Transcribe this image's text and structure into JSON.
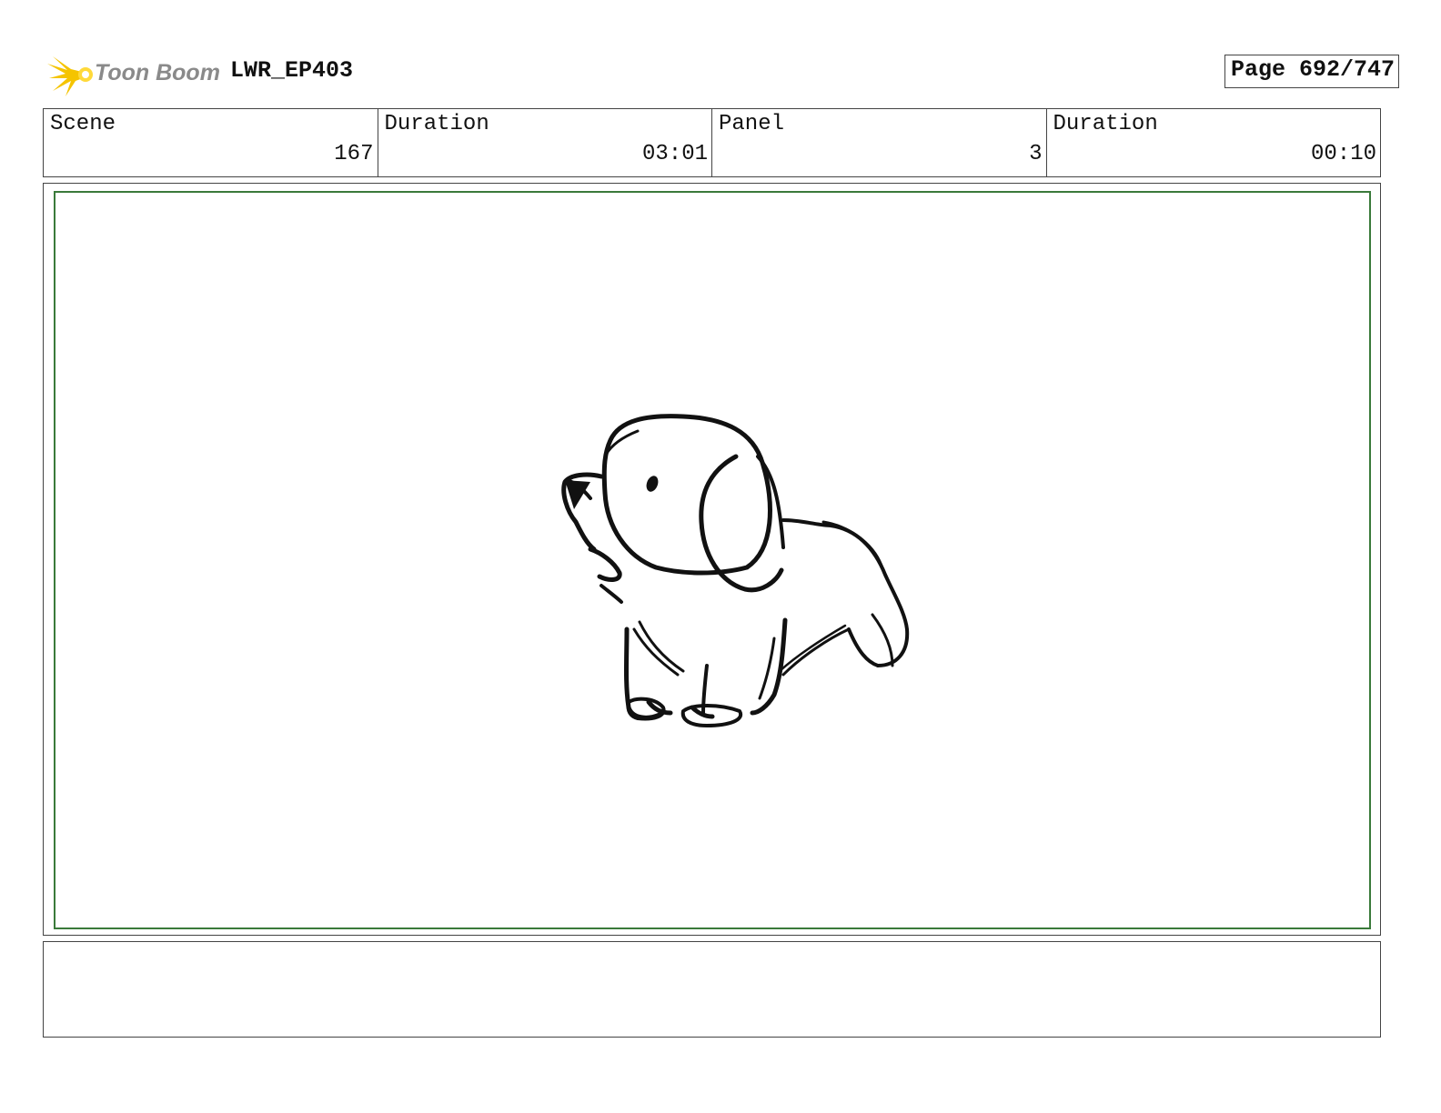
{
  "header": {
    "logo_text": "Toon Boom",
    "project_title": "LWR_EP403",
    "page_label": "Page 692/747"
  },
  "info": {
    "scene_label": "Scene",
    "scene_value": "167",
    "scene_duration_label": "Duration",
    "scene_duration_value": "03:01",
    "panel_label": "Panel",
    "panel_value": "3",
    "panel_duration_label": "Duration",
    "panel_duration_value": "00:10"
  },
  "panel": {
    "drawing_subject": "puppy-sketch",
    "frame_color": "#3a7a3a"
  },
  "notes": {
    "text": ""
  },
  "colors": {
    "logo_star": "#f5c400",
    "logo_text": "#8a8a8a",
    "border": "#444444"
  }
}
